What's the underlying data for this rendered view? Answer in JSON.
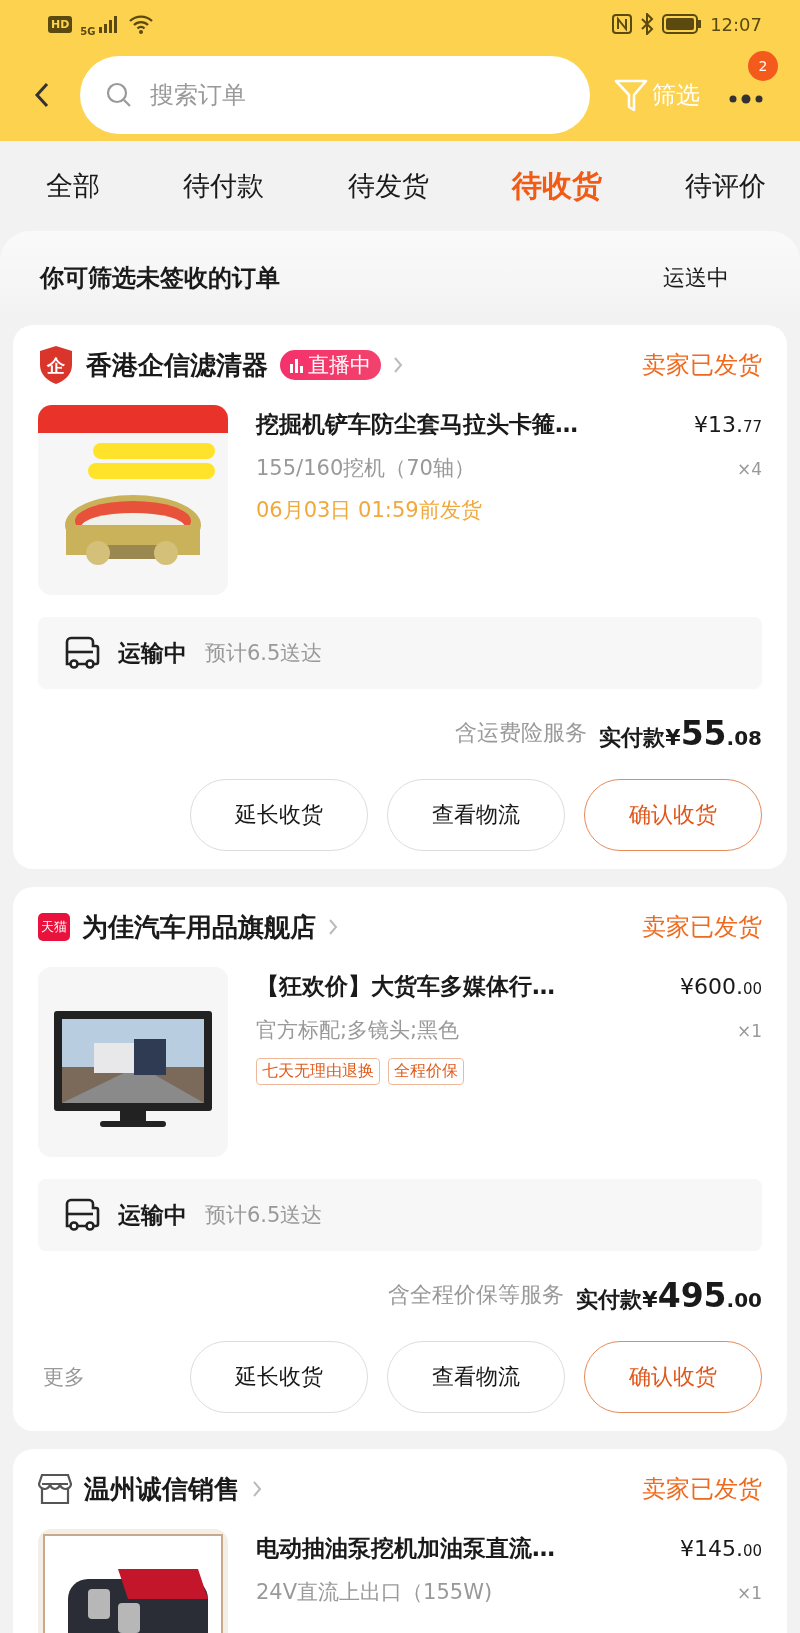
{
  "status_bar": {
    "hd": "HD",
    "network": "5G",
    "time": "12:07"
  },
  "header": {
    "search": {
      "placeholder": "搜索订单"
    },
    "filter_label": "筛选",
    "more_badge": "2"
  },
  "tabs": [
    {
      "label": "全部",
      "selected": false
    },
    {
      "label": "待付款",
      "selected": false
    },
    {
      "label": "待发货",
      "selected": false
    },
    {
      "label": "待收货",
      "selected": true
    },
    {
      "label": "待评价",
      "selected": false
    }
  ],
  "filter_bar": {
    "hint": "你可筛选未签收的订单",
    "status": "运送中"
  },
  "orders": [
    {
      "shop": {
        "kind": "shield",
        "logo_text": "企",
        "name": "香港企信滤清器",
        "live_label": "直播中"
      },
      "status": "卖家已发货",
      "items": [
        {
          "image": {
            "kind": "picture"
          },
          "title": "挖掘机铲车防尘套马拉头卡箍…",
          "price_main": "¥13.",
          "price_cents": "77",
          "spec": "155/160挖机（70轴）",
          "qty": "×4",
          "ship_by": "06月03日 01:59前发货"
        }
      ],
      "logistics": {
        "status": "运输中",
        "eta": "预计6.5送达"
      },
      "summary": {
        "services": "含运费险服务",
        "paid_label": "实付款",
        "currency": "¥",
        "amount_int": "55",
        "amount_dec": ".08"
      },
      "buttons": [
        {
          "label": "延长收货",
          "kind": "normal"
        },
        {
          "label": "查看物流",
          "kind": "normal"
        },
        {
          "label": "确认收货",
          "kind": "primary"
        }
      ]
    },
    {
      "shop": {
        "kind": "tmall",
        "logo_text": "天猫",
        "name": "为佳汽车用品旗舰店"
      },
      "status": "卖家已发货",
      "items": [
        {
          "image": {
            "kind": "picture"
          },
          "title": "【狂欢价】大货车多媒体行…",
          "price_main": "¥600.",
          "price_cents": "00",
          "spec": "官方标配;多镜头;黑色",
          "qty": "×1",
          "tags": [
            "七天无理由退换",
            "全程价保"
          ]
        }
      ],
      "logistics": {
        "status": "运输中",
        "eta": "预计6.5送达"
      },
      "summary": {
        "services": "含全程价保等服务",
        "paid_label": "实付款",
        "currency": "¥",
        "amount_int": "495",
        "amount_dec": ".00"
      },
      "more": "更多",
      "buttons": [
        {
          "label": "延长收货",
          "kind": "normal"
        },
        {
          "label": "查看物流",
          "kind": "normal"
        },
        {
          "label": "确认收货",
          "kind": "primary"
        }
      ]
    },
    {
      "shop": {
        "kind": "store",
        "name": "温州诚信销售"
      },
      "status": "卖家已发货",
      "items": [
        {
          "image": {
            "kind": "picture"
          },
          "title": "电动抽油泵挖机加油泵直流…",
          "price_main": "¥145.",
          "price_cents": "00",
          "spec": "24V直流上出口（155W)",
          "qty": "×1"
        }
      ]
    }
  ]
}
